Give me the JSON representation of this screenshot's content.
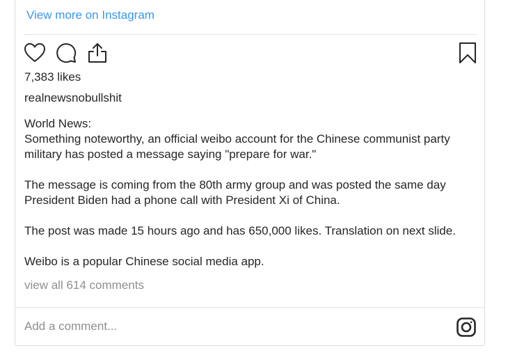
{
  "embed": {
    "view_more_label": "View more on Instagram"
  },
  "actions": {
    "icons": [
      "heart-icon",
      "comment-icon",
      "share-icon",
      "bookmark-icon"
    ]
  },
  "post": {
    "likes": "7,383 likes",
    "username": "realnewsnobullshit",
    "caption": [
      "World News:",
      "Something noteworthy, an official weibo account for the Chinese communist party military has posted a message saying \"prepare for war.\"",
      "",
      "The message is coming from the 80th army group and was posted the same day President Biden had a phone call with President Xi of China.",
      "",
      "The post was made 15 hours ago and has 650,000 likes. Translation on next slide.",
      "",
      "Weibo is a popular Chinese social media app."
    ],
    "comments_link": "view all 614 comments"
  },
  "comment_box": {
    "placeholder": "Add a comment...",
    "value": "",
    "icon": "instagram-icon"
  }
}
